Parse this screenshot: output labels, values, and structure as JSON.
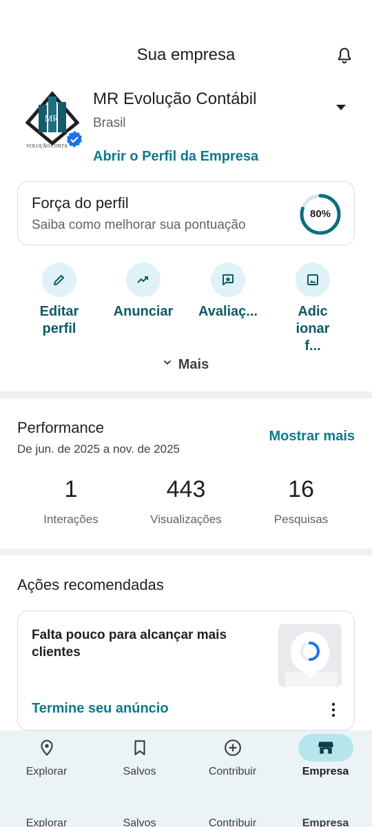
{
  "header": {
    "title": "Sua empresa",
    "icon": "bell-icon"
  },
  "business": {
    "name": "MR Evolução Contábil",
    "country": "Brasil",
    "profile_link": "Abrir o Perfil da Empresa",
    "logo_text": "MR",
    "logo_caption": "VOLUÇÃO CONTÁ"
  },
  "profile_strength": {
    "title": "Força do perfil",
    "subtitle": "Saiba como melhorar sua pontuação",
    "percent_label": "80%",
    "percent": 80
  },
  "quick_actions": [
    {
      "label": "Editar perfil",
      "icon": "pencil-icon"
    },
    {
      "label": "Anunciar",
      "icon": "trending-up-icon"
    },
    {
      "label": "Avaliaç...",
      "icon": "review-star-icon"
    },
    {
      "label": "Adic ionar f...",
      "icon": "image-icon"
    }
  ],
  "more_label": "Mais",
  "performance": {
    "title": "Performance",
    "range": "De jun. de 2025 a nov. de 2025",
    "show_more": "Mostrar mais",
    "stats": [
      {
        "value": "1",
        "label": "Interações"
      },
      {
        "value": "443",
        "label": "Visualizações"
      },
      {
        "value": "16",
        "label": "Pesquisas"
      }
    ]
  },
  "recommended": {
    "title": "Ações recomendadas",
    "card_text": "Falta pouco para alcançar mais clientes",
    "card_link": "Termine seu anúncio"
  },
  "bottom_nav": [
    {
      "label": "Explorar",
      "icon": "location-pin-icon",
      "active": false
    },
    {
      "label": "Salvos",
      "icon": "bookmark-icon",
      "active": false
    },
    {
      "label": "Contribuir",
      "icon": "add-circle-icon",
      "active": false
    },
    {
      "label": "Empresa",
      "icon": "storefront-icon",
      "active": true
    }
  ],
  "colors": {
    "accent": "#0b7a8b",
    "active_pill": "#b8e4ee",
    "action_bg": "#dff2f7"
  }
}
